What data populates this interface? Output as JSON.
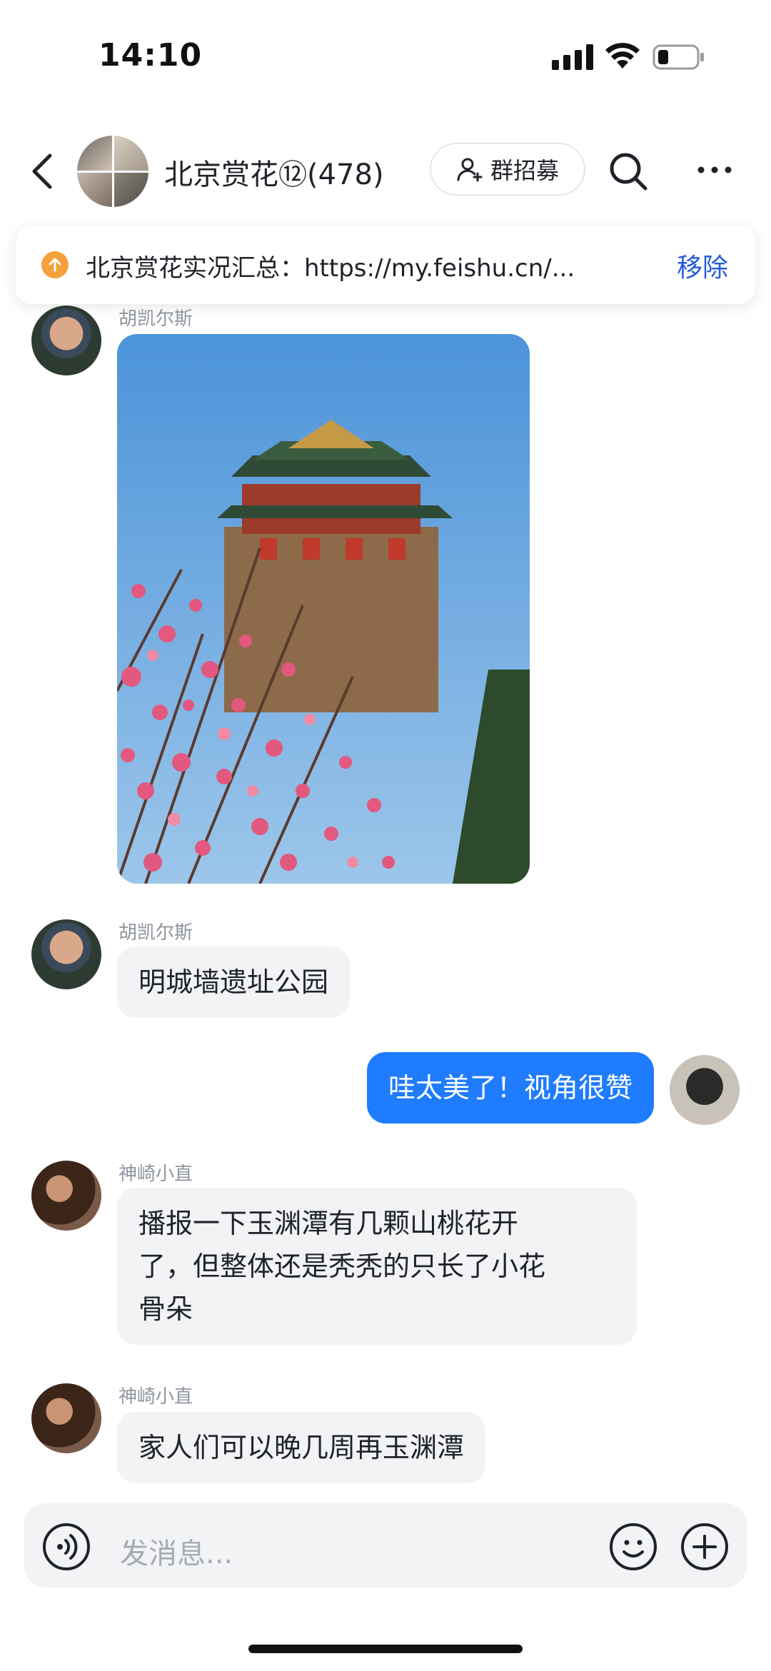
{
  "status_bar": {
    "time": "14:10"
  },
  "header": {
    "group_title": "北京赏花⑫(478)",
    "recruit_label": "群招募"
  },
  "pinned": {
    "text": "北京赏花实况汇总：https://my.feishu.cn/...",
    "action": "移除"
  },
  "messages": [
    {
      "sender": "胡凯尔斯",
      "type": "image"
    },
    {
      "sender": "胡凯尔斯",
      "text": "明城墙遗址公园"
    },
    {
      "sender": "me",
      "text": "哇太美了！视角很赞"
    },
    {
      "sender": "神崎小直",
      "lines": [
        "播报一下玉渊潭有几颗山桃花开",
        "了，但整体还是秃秃的只长了小花",
        "骨朵"
      ]
    },
    {
      "sender": "神崎小直",
      "text": "家人们可以晚几周再玉渊潭"
    }
  ],
  "input": {
    "placeholder": "发消息..."
  },
  "colors": {
    "accent": "#1f7cff",
    "link": "#245bdb",
    "bubble": "#f2f3f5",
    "pin_icon": "#f5a13b"
  },
  "icons": [
    "back-arrow-icon",
    "add-user-icon",
    "search-icon",
    "more-icon",
    "upload-icon",
    "voice-icon",
    "emoji-icon",
    "plus-icon"
  ]
}
